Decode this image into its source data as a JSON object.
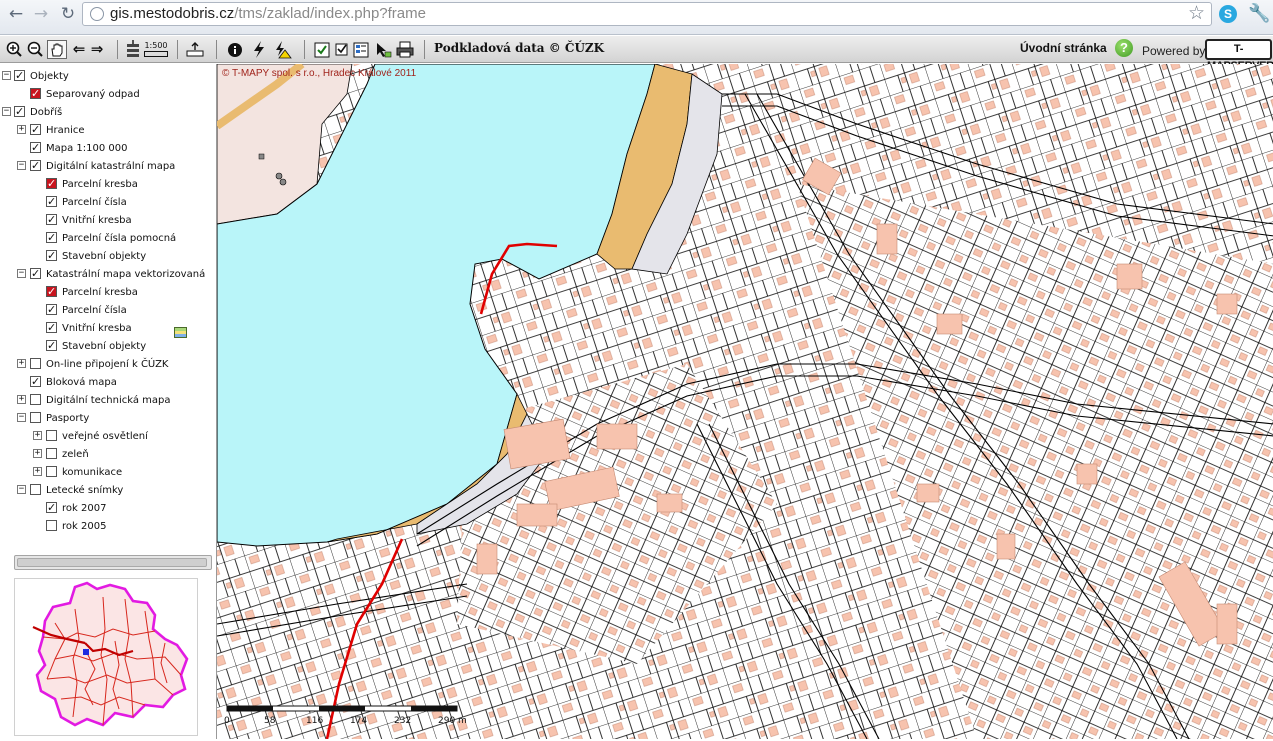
{
  "browser": {
    "url_host": "gis.mestodobris.cz",
    "url_path": "/tms/zaklad/index.php?frame",
    "back_icon": "arrow-left-icon",
    "forward_icon": "arrow-right-icon",
    "reload_icon": "reload-icon",
    "ext_label": "S"
  },
  "toolbar": {
    "scale_label": "1:500",
    "basemap_label": "Podkladová data © ČÚZK",
    "home_label": "Úvodní stránka",
    "help_label": "?",
    "powered_label": "Powered by",
    "brand_label": "T-MAPSERVER"
  },
  "tree": {
    "objekty": "Objekty",
    "separovany": "Separovaný odpad",
    "dobris": "Dobříš",
    "hranice": "Hranice",
    "mapa100": "Mapa 1:100 000",
    "dkm": "Digitální katastrální mapa",
    "dkm_parcelni_kresba": "Parcelní kresba",
    "dkm_parcelni_cisla": "Parcelní čísla",
    "dkm_vnitrni_kresba": "Vnitřní kresba",
    "dkm_parcelni_cisla_pomocna": "Parcelní čísla pomocná",
    "dkm_stavebni": "Stavební objekty",
    "kmv": "Katastrální mapa vektorizovaná",
    "kmv_parcelni_kresba": "Parcelní kresba",
    "kmv_parcelni_cisla": "Parcelní čísla",
    "kmv_vnitrni_kresba": "Vnitřní kresba",
    "kmv_stavebni": "Stavební objekty",
    "online": "On-line připojení k ČÚZK",
    "blokova": "Bloková mapa",
    "dtm": "Digitální technická mapa",
    "pasporty": "Pasporty",
    "osvetleni": "veřejné osvětlení",
    "zelen": "zeleň",
    "komunikace": "komunikace",
    "letecke": "Letecké snímky",
    "rok2007": "rok 2007",
    "rok2005": "rok 2005"
  },
  "map": {
    "copyright": "© T-MAPY spol. s r.o., Hradec Králové 2011",
    "scale_labels": [
      "0",
      "58",
      "116",
      "174",
      "232",
      "290 m"
    ],
    "colors": {
      "water": "#b9f5f9",
      "sand": "#e9bb70",
      "building": "#f7c3ae",
      "building_stroke": "#c58a73",
      "boundary": "#e00000",
      "parcel_line": "#000000"
    }
  }
}
